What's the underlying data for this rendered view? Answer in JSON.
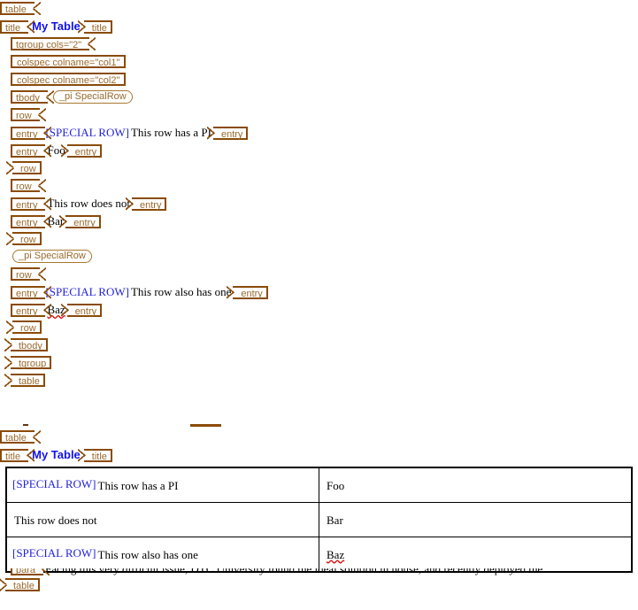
{
  "view": {
    "mode": "tags-and-render",
    "colors": {
      "tag_border": "#8a4b08",
      "tag_text": "#9a6a2e",
      "title_text": "#1111ee",
      "pi_text": "#2222dd",
      "doc_text": "#000000",
      "spell_error": "#dd0000",
      "table_border": "#000000",
      "background": "#ffffff"
    }
  },
  "tags_view": {
    "lines": [
      {
        "id": "l1",
        "kind": "start",
        "label": "table"
      },
      {
        "id": "l2",
        "kind": "start",
        "label": "title"
      },
      {
        "id": "l3",
        "kind": "start",
        "label": "tgroup cols=\"2\""
      },
      {
        "id": "l4",
        "kind": "empty",
        "label": "colspec colname=\"col1\""
      },
      {
        "id": "l5",
        "kind": "empty",
        "label": "colspec colname=\"col2\""
      },
      {
        "id": "l6",
        "kind": "start",
        "label": "tbody"
      },
      {
        "id": "l7",
        "kind": "start",
        "label": "row"
      },
      {
        "id": "l8",
        "kind": "start",
        "label": "entry"
      },
      {
        "id": "l9",
        "kind": "start",
        "label": "entry"
      },
      {
        "id": "l10",
        "kind": "end",
        "label": "row"
      },
      {
        "id": "l11",
        "kind": "start",
        "label": "row"
      },
      {
        "id": "l12",
        "kind": "start",
        "label": "entry"
      },
      {
        "id": "l13",
        "kind": "start",
        "label": "entry"
      },
      {
        "id": "l14",
        "kind": "end",
        "label": "row"
      },
      {
        "id": "l15",
        "kind": "start",
        "label": "row"
      },
      {
        "id": "l16",
        "kind": "start",
        "label": "entry"
      },
      {
        "id": "l17",
        "kind": "start",
        "label": "entry"
      },
      {
        "id": "l18",
        "kind": "end",
        "label": "row"
      },
      {
        "id": "l19",
        "kind": "end",
        "label": "tbody"
      },
      {
        "id": "l20",
        "kind": "end",
        "label": "tgroup"
      },
      {
        "id": "l21",
        "kind": "end",
        "label": "table"
      }
    ],
    "tag_labels": {
      "table": "table",
      "title": "title",
      "tgroup": "tgroup",
      "tgroup_open": "tgroup cols=\"2\"",
      "colspec_col1": "colspec colname=\"col1\"",
      "colspec_col2": "colspec colname=\"col2\"",
      "tbody": "tbody",
      "row": "row",
      "entry": "entry"
    },
    "pi": {
      "label": "_pi SpecialRow"
    },
    "content": {
      "title": "My Table",
      "special_marker": "[SPECIAL ROW]",
      "row1_entry1": "This row has a PI",
      "row1_entry2": "Foo",
      "row2_entry1": "This row does not",
      "row2_entry2": "Bar",
      "row3_entry1": "This row also has one",
      "row3_entry2": "Baz"
    }
  },
  "render_view": {
    "tag_labels": {
      "table": "table",
      "title": "title"
    },
    "title": "My Table",
    "table": {
      "rows": [
        {
          "marker": "[SPECIAL ROW]",
          "col1": "This row has a PI",
          "col2": "Foo",
          "col2_misspelled": false
        },
        {
          "marker": "",
          "col1": "This row does not",
          "col2": "Bar",
          "col2_misspelled": false
        },
        {
          "marker": "[SPECIAL ROW]",
          "col1": "This row also has one",
          "col2": "Baz",
          "col2_misspelled": true
        }
      ]
    },
    "following_paragraph": "Facing this very difficult issue, DTC University found the ideal solution in house, and recently deployed the"
  }
}
